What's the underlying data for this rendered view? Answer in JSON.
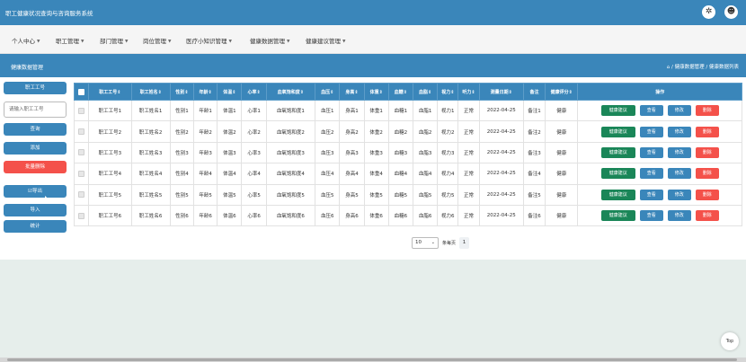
{
  "app": {
    "title": "职工健康状况查询与咨询服务系统"
  },
  "topbar_icons": {
    "settings": "✲",
    "user": "☻"
  },
  "nav": [
    {
      "label": "个人中心"
    },
    {
      "label": "职工管理"
    },
    {
      "label": "部门管理"
    },
    {
      "label": "岗位管理"
    },
    {
      "label": "医疗小知识管理"
    },
    {
      "label": "健康数据管理"
    },
    {
      "label": "健康建议管理"
    }
  ],
  "page": {
    "title": "健康数据管理",
    "breadcrumb": "⌂ / 健康数据管理 / 健康数据列表"
  },
  "sidebar": {
    "field_label": "职工工号",
    "search_placeholder": "请输入职工工号",
    "buttons": {
      "query": "查询",
      "add": "添加",
      "batch_delete": "批量删除",
      "export": "☑导出",
      "import": "导入",
      "stats": "统计"
    },
    "colors": {
      "primary": "#3a86ba",
      "danger": "#f4514a"
    }
  },
  "table": {
    "headers": [
      "职工工号⇕",
      "职工姓名⇕",
      "性别⇕",
      "年龄⇕",
      "体温⇕",
      "心率⇕",
      "血氧饱和度⇕",
      "血压⇕",
      "身高⇕",
      "体重⇕",
      "血糖⇕",
      "血脂⇕",
      "视力⇕",
      "听力⇕",
      "测量日期⇕",
      "备注",
      "健康评分⇕",
      "操作"
    ],
    "rows": [
      [
        "职工工号1",
        "职工姓名1",
        "性别1",
        "年龄1",
        "体温1",
        "心率1",
        "血氧饱和度1",
        "血压1",
        "身高1",
        "体重1",
        "血糖1",
        "血脂1",
        "视力1",
        "正常",
        "2022-04-25",
        "备注1",
        "健康"
      ],
      [
        "职工工号2",
        "职工姓名2",
        "性别2",
        "年龄2",
        "体温2",
        "心率2",
        "血氧饱和度2",
        "血压2",
        "身高2",
        "体重2",
        "血糖2",
        "血脂2",
        "视力2",
        "正常",
        "2022-04-25",
        "备注2",
        "健康"
      ],
      [
        "职工工号3",
        "职工姓名3",
        "性别3",
        "年龄3",
        "体温3",
        "心率3",
        "血氧饱和度3",
        "血压3",
        "身高3",
        "体重3",
        "血糖3",
        "血脂3",
        "视力3",
        "正常",
        "2022-04-25",
        "备注3",
        "健康"
      ],
      [
        "职工工号4",
        "职工姓名4",
        "性别4",
        "年龄4",
        "体温4",
        "心率4",
        "血氧饱和度4",
        "血压4",
        "身高4",
        "体重4",
        "血糖4",
        "血脂4",
        "视力4",
        "正常",
        "2022-04-25",
        "备注4",
        "健康"
      ],
      [
        "职工工号5",
        "职工姓名5",
        "性别5",
        "年龄5",
        "体温5",
        "心率5",
        "血氧饱和度5",
        "血压5",
        "身高5",
        "体重5",
        "血糖5",
        "血脂5",
        "视力5",
        "正常",
        "2022-04-25",
        "备注5",
        "健康"
      ],
      [
        "职工工号6",
        "职工姓名6",
        "性别6",
        "年龄6",
        "体温6",
        "心率6",
        "血氧饱和度6",
        "血压6",
        "身高6",
        "体重6",
        "血糖6",
        "血脂6",
        "视力6",
        "正常",
        "2022-04-25",
        "备注6",
        "健康"
      ]
    ],
    "actions": {
      "advice": "健康建议",
      "view": "查看",
      "edit": "修改",
      "delete": "删除"
    }
  },
  "pagination": {
    "page_size": "10",
    "page_size_arrow": "⌄",
    "per_page_label": "条每页",
    "current_page": "1"
  },
  "back_to_top": "Top"
}
